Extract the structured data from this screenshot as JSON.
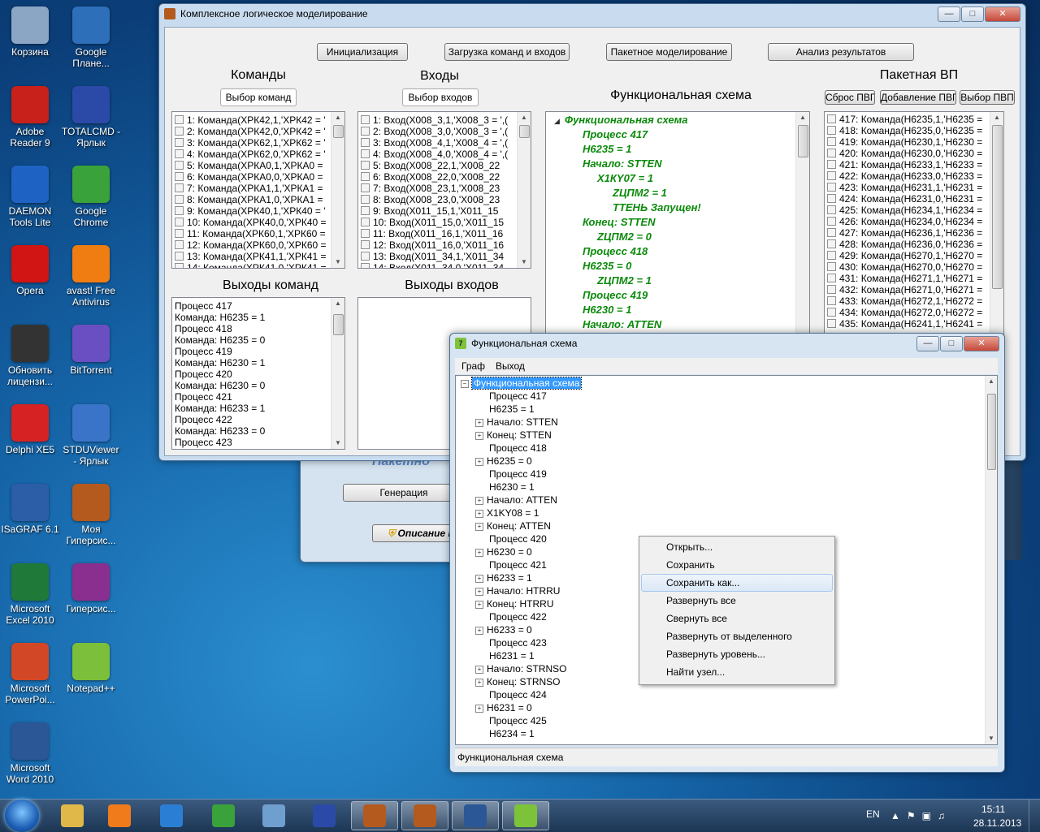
{
  "desktop_icons": [
    {
      "label": "Корзина",
      "icon": "recycle-bin-icon",
      "color": "#8aa6c4"
    },
    {
      "label": "Google Плане...",
      "icon": "google-earth-icon",
      "color": "#2d6fb8"
    },
    {
      "label": "Adobe Reader 9",
      "icon": "adobe-reader-icon",
      "color": "#c8201a"
    },
    {
      "label": "TOTALCMD - Ярлык",
      "icon": "floppy-icon",
      "color": "#2b4aa8"
    },
    {
      "label": "DAEMON Tools Lite",
      "icon": "daemon-tools-icon",
      "color": "#1e63c4"
    },
    {
      "label": "Google Chrome",
      "icon": "chrome-icon",
      "color": "#3aa23a"
    },
    {
      "label": "Opera",
      "icon": "opera-icon",
      "color": "#d11414"
    },
    {
      "label": "avast! Free Antivirus",
      "icon": "avast-icon",
      "color": "#ef7d12"
    },
    {
      "label": "Обновить лицензи...",
      "icon": "license-icon",
      "color": "#333333"
    },
    {
      "label": "BitTorrent",
      "icon": "bittorrent-icon",
      "color": "#6a4fc2"
    },
    {
      "label": "Delphi XE5",
      "icon": "delphi-icon",
      "color": "#d62222"
    },
    {
      "label": "STDUViewer - Ярлык",
      "icon": "stdu-viewer-icon",
      "color": "#3a74c9"
    },
    {
      "label": "ISaGRAF 6.1",
      "icon": "isagraf-icon",
      "color": "#2c5ea8"
    },
    {
      "label": "Моя Гиперсис...",
      "icon": "hypersys-icon",
      "color": "#b45a1e"
    },
    {
      "label": "Microsoft Excel 2010",
      "icon": "excel-icon",
      "color": "#1f7a3a"
    },
    {
      "label": "Гиперсис...",
      "icon": "winrar-icon",
      "color": "#8a2f8f"
    },
    {
      "label": "Microsoft PowerPoi...",
      "icon": "powerpoint-icon",
      "color": "#d24726"
    },
    {
      "label": "Notepad++",
      "icon": "notepadpp-icon",
      "color": "#7bbf3a"
    },
    {
      "label": "Microsoft Word 2010",
      "icon": "word-icon",
      "color": "#2b5797"
    }
  ],
  "main_window": {
    "title": "Комплексное логическое моделирование",
    "buttons": {
      "init": "Инициализация",
      "load": "Загрузка команд и входов",
      "batch": "Пакетное моделирование",
      "analysis": "Анализ результатов"
    },
    "commands": {
      "heading": "Команды",
      "select_button": "Выбор команд",
      "items": [
        "1: Команда(ХРК42,1,'ХРК42 = '",
        "2: Команда(ХРК42,0,'ХРК42 = '",
        "3: Команда(ХРК62,1,'ХРК62 = '",
        "4: Команда(ХРК62,0,'ХРК62 = '",
        "5: Команда(ХРКА0,1,'ХРКА0 = ",
        "6: Команда(ХРКА0,0,'ХРКА0 = ",
        "7: Команда(ХРКА1,1,'ХРКА1 = ",
        "8: Команда(ХРКА1,0,'ХРКА1 = ",
        "9: Команда(ХРК40,1,'ХРК40 = '",
        "10: Команда(ХРК40,0,'ХРК40 =",
        "11: Команда(ХРК60,1,'ХРК60 =",
        "12: Команда(ХРК60,0,'ХРК60 =",
        "13: Команда(ХРК41,1,'ХРК41 =",
        "14: Команда(ХРК41,0,'ХРК41 ="
      ]
    },
    "inputs": {
      "heading": "Входы",
      "select_button": "Выбор входов",
      "items": [
        "1: Вход(Х008_3,1,'Х008_3 = ',(",
        "2: Вход(Х008_3,0,'Х008_3 = ',(",
        "3: Вход(Х008_4,1,'Х008_4 = ',(",
        "4: Вход(Х008_4,0,'Х008_4 = ',(",
        "5: Вход(Х008_22,1,'Х008_22",
        "6: Вход(Х008_22,0,'Х008_22",
        "7: Вход(Х008_23,1,'Х008_23",
        "8: Вход(Х008_23,0,'Х008_23",
        "9: Вход(Х011_15,1,'Х011_15",
        "10: Вход(Х011_15,0,'Х011_15",
        "11: Вход(Х011_16,1,'Х011_16",
        "12: Вход(Х011_16,0,'Х011_16",
        "13: Вход(Х011_34,1,'Х011_34",
        "14: Вход(Х011_34,0,'Х011_34"
      ]
    },
    "func_scheme": {
      "heading": "Функциональная схема",
      "root": "Функциональная схема",
      "nodes": [
        {
          "text": "Процесс 417",
          "level": 1
        },
        {
          "text": "Н6235 = 1",
          "level": 1
        },
        {
          "text": "Начало: STTEN",
          "level": 1
        },
        {
          "text": "Х1КY07 = 1",
          "level": 2
        },
        {
          "text": "ZЦПМ2 = 1",
          "level": 3
        },
        {
          "text": "ТТЕНЬ Запущен!",
          "level": 3
        },
        {
          "text": "Конец: STTEN",
          "level": 1
        },
        {
          "text": "ZЦПМ2 = 0",
          "level": 2
        },
        {
          "text": "Процесс 418",
          "level": 1
        },
        {
          "text": "Н6235 = 0",
          "level": 1
        },
        {
          "text": "ZЦПМ2 = 1",
          "level": 2
        },
        {
          "text": "Процесс 419",
          "level": 1
        },
        {
          "text": "Н6230 = 1",
          "level": 1
        },
        {
          "text": "Начало: ATTEN",
          "level": 1
        }
      ]
    },
    "batch_vp": {
      "heading": "Пакетная ВП",
      "buttons": [
        "Сброс ПВГ",
        "Добавление ПВГ",
        "Выбор ПВП"
      ],
      "items": [
        "417: Команда(Н6235,1,'Н6235 =",
        "418: Команда(Н6235,0,'Н6235 =",
        "419: Команда(Н6230,1,'Н6230 =",
        "420: Команда(Н6230,0,'Н6230 =",
        "421: Команда(Н6233,1,'Н6233 =",
        "422: Команда(Н6233,0,'Н6233 =",
        "423: Команда(Н6231,1,'Н6231 =",
        "424: Команда(Н6231,0,'Н6231 =",
        "425: Команда(Н6234,1,'Н6234 =",
        "426: Команда(Н6234,0,'Н6234 =",
        "427: Команда(Н6236,1,'Н6236 =",
        "428: Команда(Н6236,0,'Н6236 =",
        "429: Команда(Н6270,1,'Н6270 =",
        "430: Команда(Н6270,0,'Н6270 =",
        "431: Команда(Н6271,1,'Н6271 =",
        "432: Команда(Н6271,0,'Н6271 =",
        "433: Команда(Н6272,1,'Н6272 =",
        "434: Команда(Н6272,0,'Н6272 =",
        "435: Команда(Н6241,1,'Н6241 ="
      ]
    },
    "cmd_outputs": {
      "heading": "Выходы команд",
      "items": [
        "Процесс 417",
        "Команда: Н6235 = 1",
        "Процесс 418",
        "Команда: Н6235 = 0",
        "Процесс 419",
        "Команда: Н6230 = 1",
        "Процесс 420",
        "Команда: Н6230 = 0",
        "Процесс 421",
        "Команда: Н6233 = 1",
        "Процесс 422",
        "Команда: Н6233 = 0",
        "Процесс 423"
      ]
    },
    "input_outputs": {
      "heading": "Выходы входов"
    }
  },
  "back_window": {
    "watermark": "Пакетно",
    "generate_button": "Генерация",
    "description_button": "Описание п"
  },
  "scheme_window": {
    "title": "Функциональная схема",
    "menu": [
      "Граф",
      "Выход"
    ],
    "root": "Функциональная схема",
    "nodes": [
      {
        "text": "Процесс 417",
        "expandable": false
      },
      {
        "text": "Н6235 = 1",
        "expandable": false
      },
      {
        "text": "Начало: STTEN",
        "expandable": true
      },
      {
        "text": "Конец: STTEN",
        "expandable": true
      },
      {
        "text": "Процесс 418",
        "expandable": false
      },
      {
        "text": "Н6235 = 0",
        "expandable": true
      },
      {
        "text": "Процесс 419",
        "expandable": false
      },
      {
        "text": "Н6230 = 1",
        "expandable": false
      },
      {
        "text": "Начало: ATTEN",
        "expandable": true
      },
      {
        "text": "X1KY08 = 1",
        "expandable": true
      },
      {
        "text": "Конец: ATTEN",
        "expandable": true
      },
      {
        "text": "Процесс 420",
        "expandable": false
      },
      {
        "text": "Н6230 = 0",
        "expandable": true
      },
      {
        "text": "Процесс 421",
        "expandable": false
      },
      {
        "text": "Н6233 = 1",
        "expandable": true
      },
      {
        "text": "Начало:  HTRRU",
        "expandable": true
      },
      {
        "text": "Конец:  HTRRU",
        "expandable": true
      },
      {
        "text": "Процесс 422",
        "expandable": false
      },
      {
        "text": "Н6233 = 0",
        "expandable": true
      },
      {
        "text": "Процесс 423",
        "expandable": false
      },
      {
        "text": "Н6231 = 1",
        "expandable": false
      },
      {
        "text": "Начало:  STRNSO",
        "expandable": true
      },
      {
        "text": "Конец: STRNSO",
        "expandable": true
      },
      {
        "text": "Процесс 424",
        "expandable": false
      },
      {
        "text": "Н6231 = 0",
        "expandable": true
      },
      {
        "text": "Процесс 425",
        "expandable": false
      },
      {
        "text": "Н6234 = 1",
        "expandable": false
      }
    ],
    "status": "Функциональная схема"
  },
  "context_menu": {
    "items": [
      "Открыть...",
      "Сохранить",
      "Сохранить как...",
      "Развернуть все",
      "Свернуть все",
      "Развернуть от выделенного",
      "Развернуть уровень...",
      "Найти узел..."
    ],
    "selected": "Сохранить как..."
  },
  "taskbar": {
    "items": [
      {
        "name": "explorer",
        "color": "#e0b84a"
      },
      {
        "name": "media-player",
        "color": "#f07b1a"
      },
      {
        "name": "internet-explorer",
        "color": "#2a7fd4"
      },
      {
        "name": "chrome",
        "color": "#3aa23a"
      },
      {
        "name": "notepad",
        "color": "#6f9fcf"
      },
      {
        "name": "floppy",
        "color": "#2b4aa8"
      },
      {
        "name": "app1",
        "color": "#b45a1e"
      },
      {
        "name": "app2",
        "color": "#b45a1e"
      },
      {
        "name": "word",
        "color": "#2b5797"
      },
      {
        "name": "app7",
        "color": "#7cc33a"
      }
    ],
    "language": "EN",
    "time": "15:11",
    "date": "28.11.2013"
  }
}
